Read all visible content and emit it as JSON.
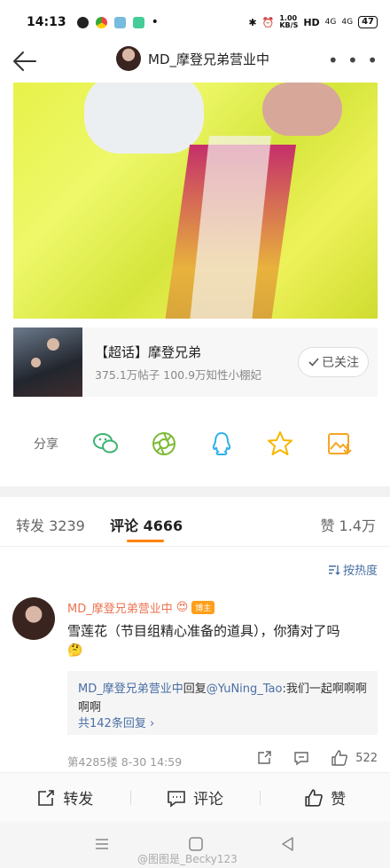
{
  "status_bar": {
    "time": "14:13",
    "net_speed": "1.00\nKB/S",
    "hd": "HD",
    "signal1": "4G",
    "signal2": "4G",
    "battery": "47"
  },
  "nav": {
    "back_icon": "arrow-left-icon",
    "title": "MD_摩登兄弟营业中",
    "more_icon": "more-dots-icon"
  },
  "topic": {
    "name": "【超话】摩登兄弟",
    "stats": "375.1万帖子 100.9万知性小棚妃",
    "follow_label": "已关注"
  },
  "share": {
    "label": "分享",
    "targets": [
      "wechat-icon",
      "moments-icon",
      "qq-icon",
      "qzone-icon",
      "save-image-icon"
    ]
  },
  "tabs": {
    "repost": "转发 3239",
    "comment": "评论 4666",
    "like": "赞 1.4万"
  },
  "sort_label": "按热度",
  "comment": {
    "username": "MD_摩登兄弟营业中",
    "badge": "博主",
    "text": "雪莲花（节目组精心准备的道具），你猜对了吗",
    "reply_user": "MD_摩登兄弟营业中",
    "reply_word": "回复",
    "reply_mention": "@YuNing_Tao",
    "reply_text": ":我们一起啊啊啊啊啊",
    "reply_count": "共142条回复",
    "floor_time": "第4285楼 8-30 14:59",
    "like_count": "522"
  },
  "bottom_bar": {
    "repost": "转发",
    "comment": "评论",
    "like": "赞"
  },
  "watermark": "@图图是_Becky123",
  "colors": {
    "accent": "#ff8200",
    "link": "#4a6fa5",
    "username": "#eb7350",
    "wechat": "#3cb371"
  }
}
